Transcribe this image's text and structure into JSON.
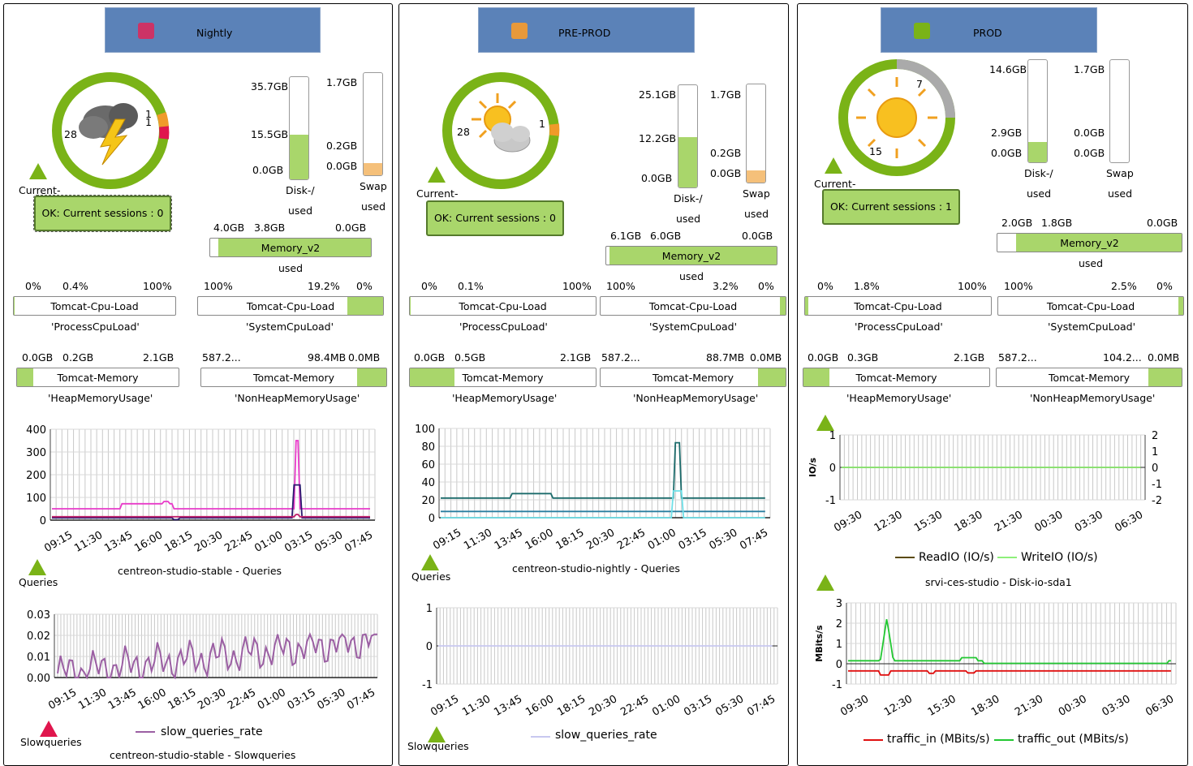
{
  "panels": [
    {
      "title": "Nightly",
      "status_color": "#cc3366",
      "donut": {
        "left": "28",
        "right_top": "1",
        "right_bottom": "1"
      },
      "current_label": "Current-",
      "ok_text": "OK: Current sessions : 0",
      "disk": {
        "top": "35.7GB",
        "mid": "15.5GB",
        "bottom": "0.0GB",
        "name": "Disk-/",
        "used": "used",
        "fill_pct": 44
      },
      "swap": {
        "top": "1.7GB",
        "mid": "0.2GB",
        "bottom": "0.0GB",
        "name": "Swap",
        "used": "used",
        "fill_pct": 12
      },
      "memory": {
        "l1": "4.0GB",
        "l2": "3.8GB",
        "l3": "0.0GB",
        "name": "Memory_v2",
        "used": "used",
        "fill_pct": 95
      },
      "cpu1": {
        "a": "0%",
        "b": "0.4%",
        "c": "100%",
        "name": "Tomcat-Cpu-Load",
        "sub": "'ProcessCpuLoad'",
        "fill_pct": 0.4
      },
      "cpu2": {
        "a": "100%",
        "b": "19.2%",
        "c": "0%",
        "name": "Tomcat-Cpu-Load",
        "sub": "'SystemCpuLoad'",
        "fill_pct": 19.2
      },
      "mem1": {
        "a": "0.0GB",
        "b": "0.2GB",
        "c": "2.1GB",
        "name": "Tomcat-Memory",
        "sub": "'HeapMemoryUsage'",
        "fill_pct": 10
      },
      "mem2": {
        "a": "587.2...",
        "b": "98.4MB",
        "c": "0.0MB",
        "name": "Tomcat-Memory",
        "sub": "'NonHeapMemoryUsage'",
        "fill_pct": 16
      },
      "graph1_label": "Queries",
      "graph1_caption": "centreon-studio-stable  -  Queries",
      "graph2_label": "Slowqueries",
      "graph2_legend": "slow_queries_rate",
      "graph2_caption": "centreon-studio-stable  -  Slowqueries"
    },
    {
      "title": "PRE-PROD",
      "status_color": "#e8993a",
      "donut": {
        "left": "28",
        "right_top": "1"
      },
      "current_label": "Current-",
      "ok_text": "OK: Current sessions : 0",
      "disk": {
        "top": "25.1GB",
        "mid": "12.2GB",
        "bottom": "0.0GB",
        "name": "Disk-/",
        "used": "used",
        "fill_pct": 49
      },
      "swap": {
        "top": "1.7GB",
        "mid": "0.2GB",
        "bottom": "0.0GB",
        "name": "Swap",
        "used": "used",
        "fill_pct": 12
      },
      "memory": {
        "l1": "6.1GB",
        "l2": "6.0GB",
        "l3": "0.0GB",
        "name": "Memory_v2",
        "used": "used",
        "fill_pct": 98
      },
      "cpu1": {
        "a": "0%",
        "b": "0.1%",
        "c": "100%",
        "name": "Tomcat-Cpu-Load",
        "sub": "'ProcessCpuLoad'",
        "fill_pct": 0.1
      },
      "cpu2": {
        "a": "100%",
        "b": "3.2%",
        "c": "0%",
        "name": "Tomcat-Cpu-Load",
        "sub": "'SystemCpuLoad'",
        "fill_pct": 3.2
      },
      "mem1": {
        "a": "0.0GB",
        "b": "0.5GB",
        "c": "2.1GB",
        "name": "Tomcat-Memory",
        "sub": "'HeapMemoryUsage'",
        "fill_pct": 24
      },
      "mem2": {
        "a": "587.2...",
        "b": "88.7MB",
        "c": "0.0MB",
        "name": "Tomcat-Memory",
        "sub": "'NonHeapMemoryUsage'",
        "fill_pct": 15
      },
      "graph1_label": "Queries",
      "graph1_caption": "centreon-studio-nightly  -  Queries",
      "graph2_label": "Slowqueries",
      "graph2_legend": "slow_queries_rate"
    },
    {
      "title": "PROD",
      "status_color": "#7ab317",
      "donut": {
        "top": "7",
        "bottom": "15"
      },
      "current_label": "Current-",
      "ok_text": "OK: Current sessions : 1",
      "disk": {
        "top": "14.6GB",
        "mid": "2.9GB",
        "bottom": "0.0GB",
        "name": "Disk-/",
        "used": "used",
        "fill_pct": 20
      },
      "swap": {
        "top": "1.7GB",
        "mid": "0.0GB",
        "bottom": "0.0GB",
        "name": "Swap",
        "used": "used",
        "fill_pct": 0
      },
      "memory": {
        "l1": "2.0GB",
        "l2": "1.8GB",
        "l3": "0.0GB",
        "name": "Memory_v2",
        "used": "used",
        "fill_pct": 90
      },
      "cpu1": {
        "a": "0%",
        "b": "1.8%",
        "c": "100%",
        "name": "Tomcat-Cpu-Load",
        "sub": "'ProcessCpuLoad'",
        "fill_pct": 1.8
      },
      "cpu2": {
        "a": "100%",
        "b": "2.5%",
        "c": "0%",
        "name": "Tomcat-Cpu-Load",
        "sub": "'SystemCpuLoad'",
        "fill_pct": 2.5
      },
      "mem1": {
        "a": "0.0GB",
        "b": "0.3GB",
        "c": "2.1GB",
        "name": "Tomcat-Memory",
        "sub": "'HeapMemoryUsage'",
        "fill_pct": 14
      },
      "mem2": {
        "a": "587.2...",
        "b": "104.2...",
        "c": "0.0MB",
        "name": "Tomcat-Memory",
        "sub": "'NonHeapMemoryUsage'",
        "fill_pct": 18
      },
      "graph1_ylabel": "IO/s",
      "graph1_legend1": "ReadIO (IO/s)",
      "graph1_legend2": "WriteIO (IO/s)",
      "graph1_caption": "srvi-ces-studio - Disk-io-sda1",
      "graph2_ylabel": "MBits/s",
      "graph2_legend1": "traffic_in (MBits/s)",
      "graph2_legend2": "traffic_out (MBits/s)"
    }
  ],
  "chart_data": [
    {
      "type": "line",
      "x": [
        "09:15",
        "11:30",
        "13:45",
        "16:00",
        "18:15",
        "20:30",
        "22:45",
        "01:00",
        "03:15",
        "05:30",
        "07:45"
      ],
      "yticks": [
        "400",
        "300",
        "200",
        "100",
        "0"
      ],
      "ylim": [
        0,
        400
      ],
      "series": [
        {
          "color": "#e83bc9"
        },
        {
          "color": "#2b1a6e"
        },
        {
          "color": "#c0206a"
        }
      ]
    },
    {
      "type": "line",
      "x": [
        "09:15",
        "11:30",
        "13:45",
        "16:00",
        "18:15",
        "20:30",
        "22:45",
        "01:00",
        "03:15",
        "05:30",
        "07:45"
      ],
      "yticks": [
        "0.03",
        "0.02",
        "0.01",
        "0.00"
      ],
      "ylim": [
        0,
        0.03
      ],
      "series": [
        {
          "name": "slow_queries_rate",
          "color": "#9b5fa3"
        }
      ]
    },
    {
      "type": "line",
      "x": [
        "09:15",
        "11:30",
        "13:45",
        "16:00",
        "18:15",
        "20:30",
        "22:45",
        "01:00",
        "03:15",
        "05:30",
        "07:45"
      ],
      "yticks": [
        "100",
        "80",
        "60",
        "40",
        "20",
        "0"
      ],
      "ylim": [
        0,
        100
      ],
      "series": [
        {
          "color": "#1b6b6b"
        },
        {
          "color": "#2a7fa0"
        },
        {
          "color": "#6fe0e8"
        }
      ]
    },
    {
      "type": "line",
      "x": [
        "09:15",
        "11:30",
        "13:45",
        "16:00",
        "18:15",
        "20:30",
        "22:45",
        "01:00",
        "03:15",
        "05:30",
        "07:45"
      ],
      "yticks": [
        "1",
        "0",
        "-1"
      ],
      "ylim": [
        -1,
        1
      ],
      "series": [
        {
          "name": "slow_queries_rate",
          "color": "#c8c8f0"
        }
      ]
    },
    {
      "type": "line",
      "x": [
        "09:30",
        "12:30",
        "15:30",
        "18:30",
        "21:30",
        "00:30",
        "03:30",
        "06:30"
      ],
      "yticks": [
        "1",
        "0",
        "-1"
      ],
      "yticks_right": [
        "2",
        "1",
        "0",
        "-1",
        "-2"
      ],
      "ylabel": "IO/s",
      "series": [
        {
          "name": "ReadIO (IO/s)",
          "color": "#5a4a08"
        },
        {
          "name": "WriteIO (IO/s)",
          "color": "#8ef07a"
        }
      ]
    },
    {
      "type": "line",
      "x": [
        "09:30",
        "12:30",
        "15:30",
        "18:30",
        "21:30",
        "00:30",
        "03:30",
        "06:30"
      ],
      "yticks": [
        "3",
        "2",
        "1",
        "0",
        "-1"
      ],
      "ylim": [
        -1,
        3
      ],
      "ylabel": "MBits/s",
      "series": [
        {
          "name": "traffic_in (MBits/s)",
          "color": "#e01010"
        },
        {
          "name": "traffic_out (MBits/s)",
          "color": "#22c832"
        }
      ]
    }
  ]
}
